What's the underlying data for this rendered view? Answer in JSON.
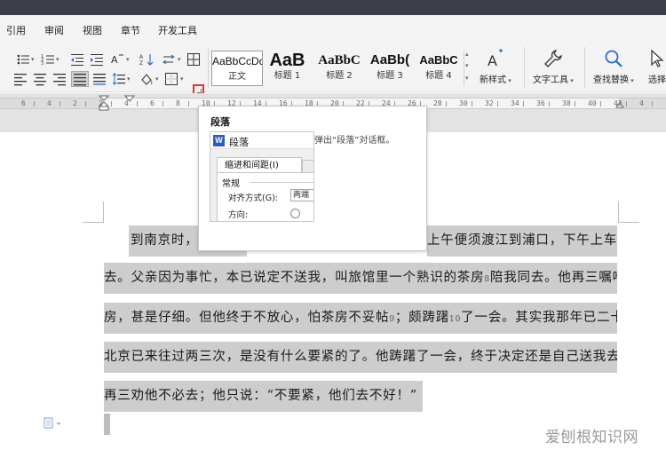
{
  "menu": {
    "items": [
      "引用",
      "审阅",
      "视图",
      "章节",
      "开发工具"
    ]
  },
  "styles": [
    {
      "preview": "AaBbCcDd",
      "name": "正文"
    },
    {
      "preview": "AaB",
      "name": "标题 1"
    },
    {
      "preview": "AaBbC",
      "name": "标题 2"
    },
    {
      "preview": "AaBb(",
      "name": "标题 3"
    },
    {
      "preview": "AaBbC",
      "name": "标题 4"
    }
  ],
  "ribbon_buttons": {
    "new_style": "新样式",
    "text_tools": "文字工具",
    "find_replace": "查找替换",
    "select": "选择"
  },
  "ruler_numbers": [
    "6",
    "4",
    "2",
    "2",
    "4",
    "6",
    "8",
    "10",
    "12",
    "14",
    "16",
    "18",
    "20",
    "22",
    "24",
    "26",
    "28",
    "30",
    "32",
    "34",
    "36",
    "38",
    "40",
    "42",
    "4"
  ],
  "tooltip": {
    "title": "段落",
    "description": "弹出“段落”对话框。",
    "dialog_title": "段落",
    "tab": "缩进和间距(I)",
    "section": "常规",
    "align_label": "对齐方式(G):",
    "align_value": "两端",
    "direction_label": "方向:"
  },
  "document": {
    "line1_start": "到南京时，有",
    "line1_end": "上午便须渡江到浦口，下午上车北",
    "line2": "去。父亲因为事忙，本已说定不送我，叫旅馆里一个熟识的茶房",
    "line2_note": "8",
    "line2_tail": "陪我同去。他再三嘱咐茶",
    "line3_a": "房，甚是仔细。但他终于不放心，怕茶房不妥帖",
    "line3_note1": "9",
    "line3_b": "；颇踌躇",
    "line3_note2": "10",
    "line3_c": "了一会。其实我那年已二十岁，",
    "line4": "北京已来往过两三次，是没有什么要紧的了。他踌躇了一会，终于决定还是自己送我去。我",
    "line5": "再三劝他不必去；他只说：“不要紧，他们去不好！”"
  },
  "watermark": "爱刨根知识网"
}
